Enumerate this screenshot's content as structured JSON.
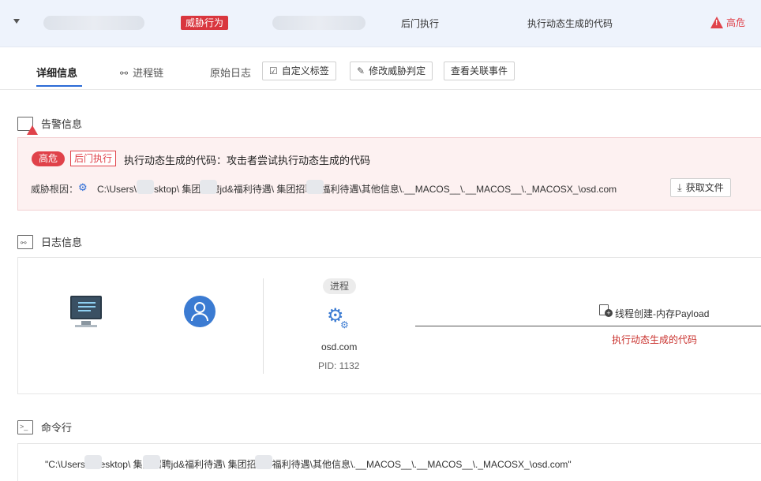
{
  "header": {
    "threat_tag": "威胁行为",
    "category": "后门执行",
    "behavior": "执行动态生成的代码",
    "level": "高危",
    "level_icon": "warning-triangle-icon"
  },
  "tabs": [
    {
      "label": "详细信息",
      "active": true
    },
    {
      "label": "进程链",
      "icon": "process-chain-icon"
    },
    {
      "label": "原始日志"
    }
  ],
  "actions": {
    "custom_tag": "自定义标签",
    "modify_verdict": "修改威胁判定",
    "view_related": "查看关联事件"
  },
  "alert_section": {
    "title": "告警信息",
    "level": "高危",
    "category": "后门执行",
    "description": "执行动态生成的代码：攻击者尝试执行动态生成的代码",
    "root_cause_label": "威胁根因：",
    "root_cause_path": "C:\\Users\\    \\Desktop\\     集团招聘jd&福利待遇\\      集团招聘&福利待遇\\其他信息\\.__MACOS__\\.__MACOS__\\._MACOSX_\\osd.com",
    "get_file_label": "获取文件"
  },
  "log_section": {
    "title": "日志信息",
    "process_label": "进程",
    "process_name": "osd.com",
    "pid": "PID: 1132",
    "flow_label": "线程创建-内存Payload",
    "flow_sub": "执行动态生成的代码"
  },
  "cmd_section": {
    "title": "命令行",
    "command": "\"C:\\Users\\    \\Desktop\\     集团招聘jd&福利待遇\\      集团招聘&福利待遇\\其他信息\\.__MACOS__\\.__MACOS__\\._MACOSX_\\osd.com\""
  },
  "colors": {
    "accent": "#2b6bd6",
    "danger": "#e0424a",
    "header_bg": "#eef3fc"
  }
}
